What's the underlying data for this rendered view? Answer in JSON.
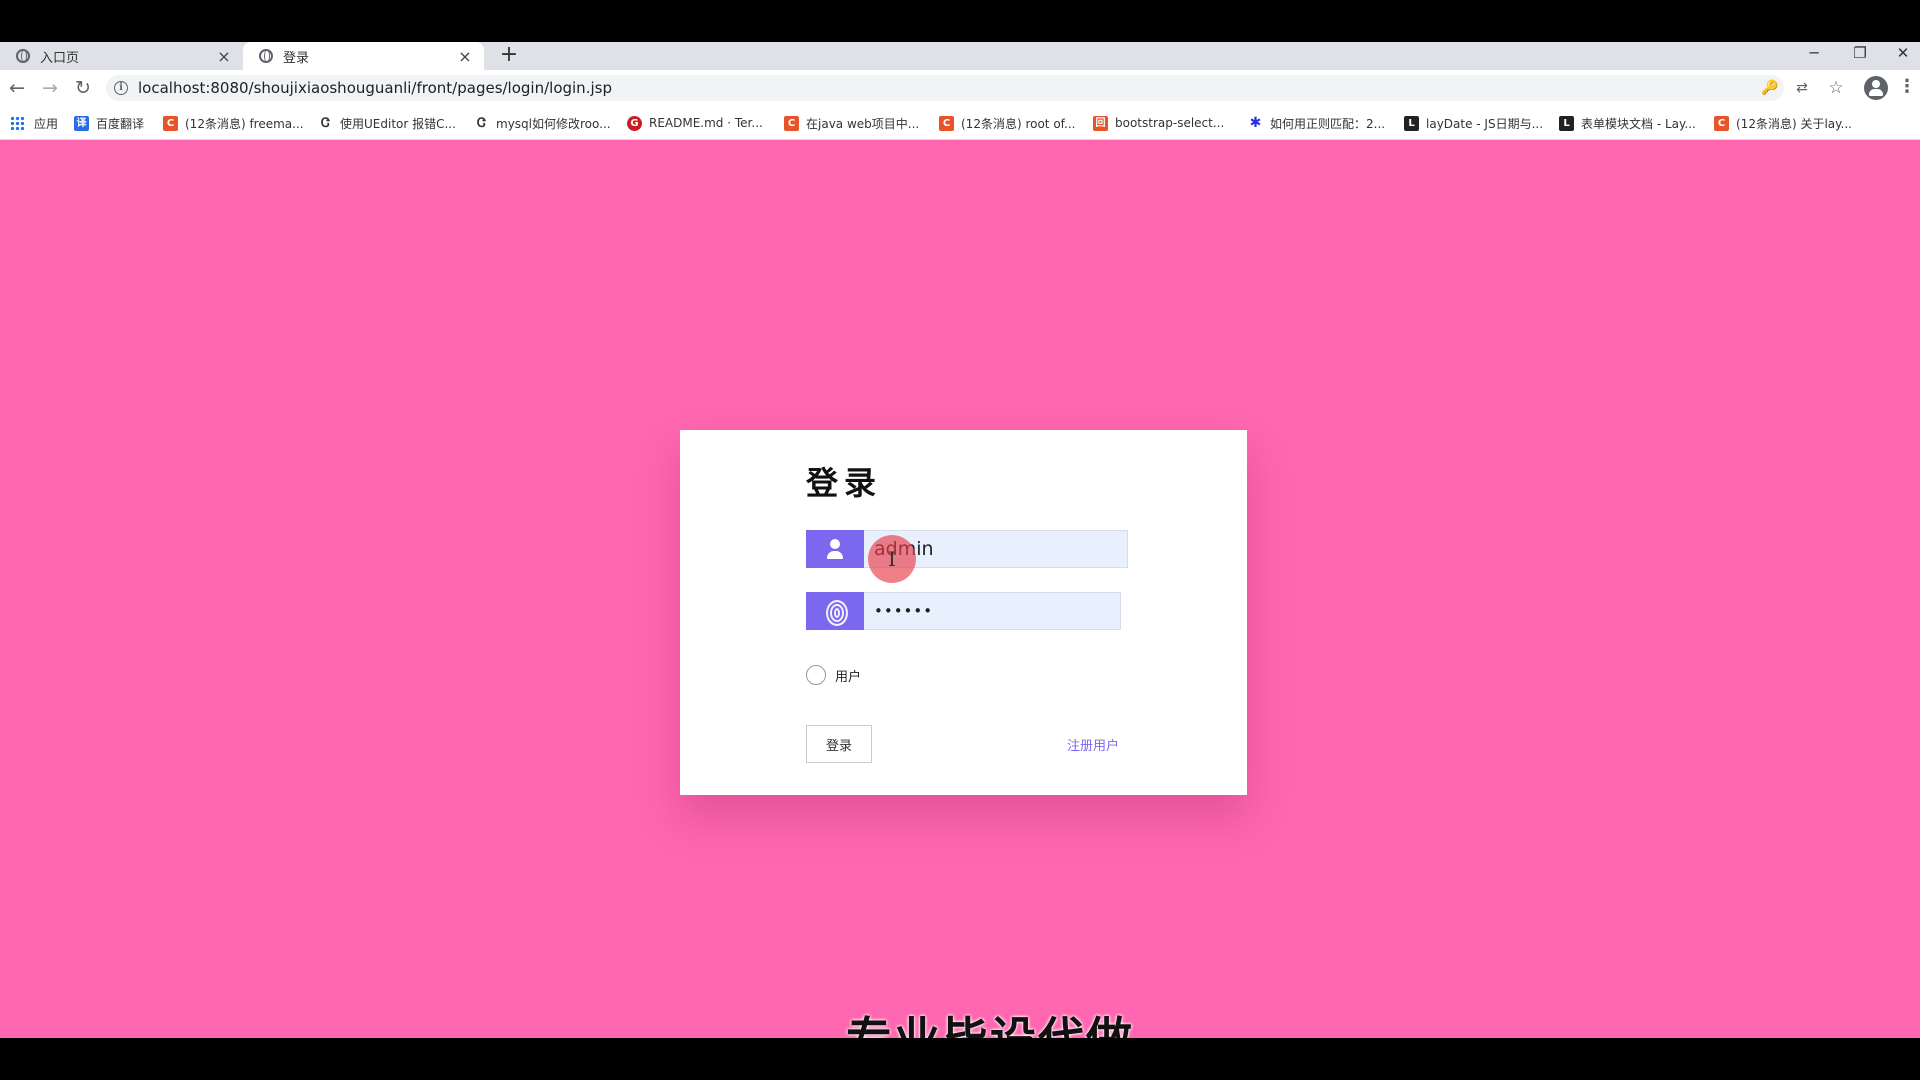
{
  "browser": {
    "tabs": [
      {
        "title": "入口页",
        "close": "×"
      },
      {
        "title": "登录",
        "close": "×"
      }
    ],
    "new_tab": "+",
    "window_controls": {
      "minimize": "─",
      "restore": "❐",
      "close": "✕"
    },
    "nav": {
      "back": "←",
      "forward": "→",
      "reload": "↻"
    },
    "url": "localhost:8080/shoujixiaoshouguanli/front/pages/login/login.jsp",
    "omnibox_icons": {
      "key": "🔑",
      "translate": "⇄",
      "star": "☆"
    },
    "menu": "⋮",
    "bookmarks": [
      {
        "label": "应用",
        "icon": "apps-grid",
        "color": "#1a73e8"
      },
      {
        "label": "百度翻译",
        "icon": "baidu-translate",
        "color": "#2b6de5",
        "glyph": "译"
      },
      {
        "label": "(12条消息) freema...",
        "icon": "csdn",
        "color": "#e8542a",
        "glyph": "C"
      },
      {
        "label": "使用UEditor 报错C...",
        "icon": "bookmark-link",
        "color": "#333333",
        "glyph": "Ꮳ"
      },
      {
        "label": "mysql如何修改roo...",
        "icon": "bookmark-link",
        "color": "#333333",
        "glyph": "Ꮳ"
      },
      {
        "label": "README.md · Ter...",
        "icon": "gitee",
        "color": "#c71d23",
        "glyph": "G"
      },
      {
        "label": "在java web项目中...",
        "icon": "csdn",
        "color": "#e8542a",
        "glyph": "C"
      },
      {
        "label": "(12条消息) root of...",
        "icon": "csdn",
        "color": "#e8542a",
        "glyph": "C"
      },
      {
        "label": "bootstrap-select...",
        "icon": "bootstrap",
        "color": "#e8542a",
        "glyph": "回"
      },
      {
        "label": "如何用正则匹配：2...",
        "icon": "baidu-paw",
        "color": "#2932e1",
        "glyph": "✱"
      },
      {
        "label": "layDate - JS日期与...",
        "icon": "layui",
        "color": "#222222",
        "glyph": "L"
      },
      {
        "label": "表单模块文档 - Lay...",
        "icon": "layui",
        "color": "#222222",
        "glyph": "L"
      },
      {
        "label": "(12条消息) 关于lay...",
        "icon": "csdn",
        "color": "#e8542a",
        "glyph": "C"
      }
    ]
  },
  "login": {
    "title": "登录",
    "username_value": "admin",
    "password_value": "••••••",
    "role_label": "用户",
    "login_button": "登录",
    "register_link": "注册用户",
    "accent_color": "#7b68ee",
    "background_color": "#ff67b0"
  },
  "cursor": {
    "glyph": "I"
  },
  "subtitle": "专业毕设代做"
}
